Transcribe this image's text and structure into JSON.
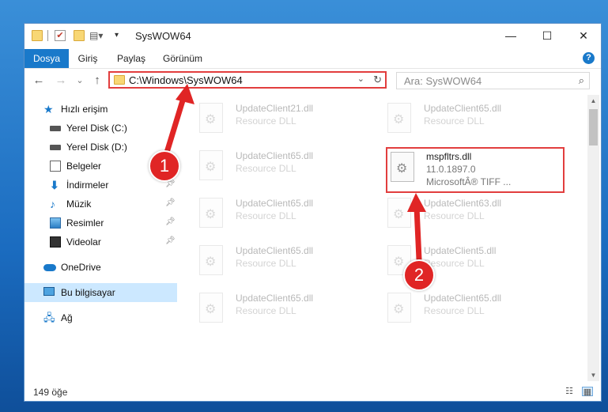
{
  "window": {
    "title": "SysWOW64"
  },
  "controls": {
    "minimize": "—",
    "maximize": "☐",
    "close": "✕"
  },
  "ribbon": {
    "tabs": [
      {
        "label": "Dosya",
        "active": true
      },
      {
        "label": "Giriş"
      },
      {
        "label": "Paylaş"
      },
      {
        "label": "Görünüm"
      }
    ],
    "help": "?"
  },
  "nav": {
    "back": "←",
    "forward": "→",
    "recent": "⌄",
    "up": "↑"
  },
  "address": {
    "path": "C:\\Windows\\SysWOW64",
    "dropdown": "⌄",
    "refresh": "↻"
  },
  "search": {
    "placeholder": "Ara: SysWOW64",
    "icon": "⌕"
  },
  "sidebar": {
    "items": [
      {
        "label": "Hızlı erişim",
        "icon": "star-icon"
      },
      {
        "label": "Yerel Disk (C:)",
        "icon": "drive-icon"
      },
      {
        "label": "Yerel Disk (D:)",
        "icon": "drive-icon"
      },
      {
        "label": "Belgeler",
        "icon": "document-icon"
      },
      {
        "label": "İndirmeler",
        "icon": "download-icon",
        "pinned": true
      },
      {
        "label": "Müzik",
        "icon": "music-icon",
        "pinned": true
      },
      {
        "label": "Resimler",
        "icon": "pictures-icon",
        "pinned": true
      },
      {
        "label": "Videolar",
        "icon": "video-icon",
        "pinned": true
      },
      {
        "label": "OneDrive",
        "icon": "cloud-icon"
      },
      {
        "label": "Bu bilgisayar",
        "icon": "computer-icon",
        "selected": true
      },
      {
        "label": "Ağ",
        "icon": "network-icon"
      }
    ]
  },
  "files": {
    "left": [
      {
        "name": "UpdateClient21.dll",
        "desc": "Resource DLL"
      },
      {
        "name": "UpdateClient65.dll",
        "desc": "Resource DLL"
      },
      {
        "name": "UpdateClient65.dll",
        "desc": "Resource DLL"
      },
      {
        "name": "UpdateClient65.dll",
        "desc": "Resource DLL"
      },
      {
        "name": "UpdateClient65.dll",
        "desc": "Resource DLL"
      }
    ],
    "right": [
      {
        "name": "UpdateClient65.dll",
        "desc": "Resource DLL"
      },
      {
        "name": "mspfltrs.dll",
        "desc": "11.0.1897.0",
        "extra": "MicrosoftÂ® TIFF ...",
        "highlight": true
      },
      {
        "name": "UpdateClient63.dll",
        "desc": "Resource DLL"
      },
      {
        "name": "UpdateClient5.dll",
        "desc": "Resource DLL"
      },
      {
        "name": "UpdateClient65.dll",
        "desc": "Resource DLL"
      }
    ]
  },
  "status": {
    "count": "149 öğe"
  },
  "annotations": {
    "badge1": "1",
    "badge2": "2",
    "color": "#e02525"
  }
}
